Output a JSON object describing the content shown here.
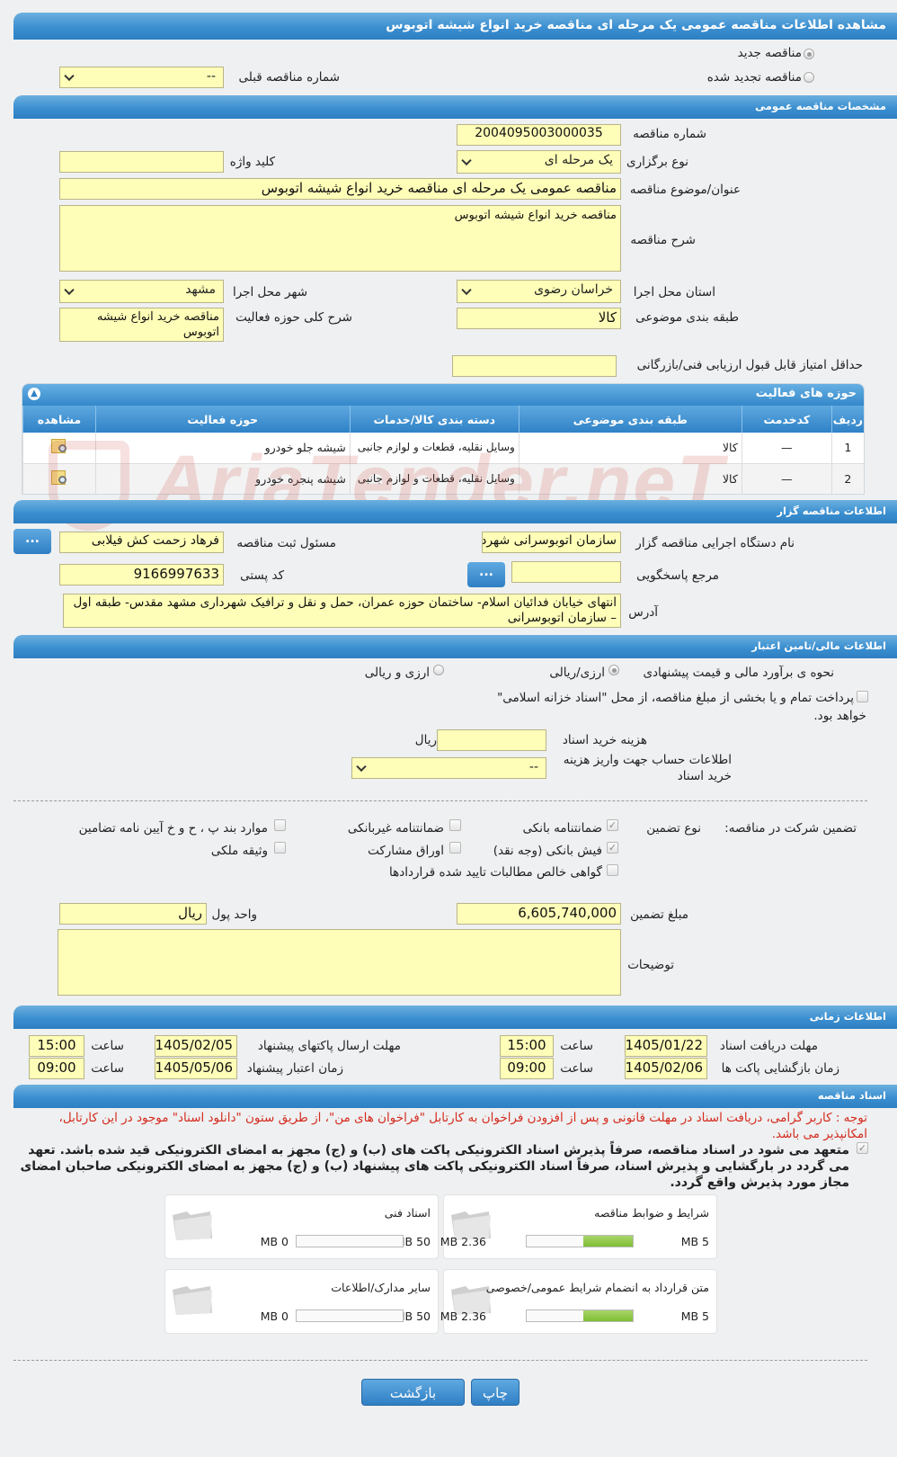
{
  "header": {
    "title": "مشاهده اطلاعات مناقصه عمومی یک مرحله ای مناقصه خرید انواع شیشه اتوبوس"
  },
  "tender_type": {
    "new_label": "مناقصه جدید",
    "renewed_label": "مناقصه تجدید شده",
    "prev_number_label": "شماره مناقصه قبلی",
    "prev_number_value": "--"
  },
  "general": {
    "section_title": "مشخصات مناقصه عمومی",
    "number_label": "شماره مناقصه",
    "number_value": "2004095003000035",
    "holding_type_label": "نوع برگزاری",
    "holding_type_value": "یک مرحله ای",
    "keyword_label": "کلید واژه",
    "keyword_value": "",
    "subject_label": "عنوان/موضوع مناقصه",
    "subject_value": "مناقصه عمومی یک مرحله ای مناقصه خرید انواع شیشه اتوبوس",
    "description_label": "شرح مناقصه",
    "description_value": "مناقصه خرید انواع شیشه اتوبوس",
    "province_label": "استان محل اجرا",
    "province_value": "خراسان رضوی",
    "city_label": "شهر محل اجرا",
    "city_value": "مشهد",
    "category_label": "طبقه بندی موضوعی",
    "category_value": "کالا",
    "activity_desc_label": "شرح کلی حوزه فعالیت",
    "activity_desc_value": "مناقصه خرید انواع شیشه اتوبوس",
    "min_score_label": "حداقل امتیاز قابل قبول ارزیابی فنی/بازرگانی",
    "min_score_value": ""
  },
  "activity": {
    "title": "حوزه های فعالیت",
    "columns": [
      "ردیف",
      "کدخدمت",
      "طبقه بندی موضوعی",
      "دسته بندی کالا/خدمات",
      "حوزه فعالیت",
      "مشاهده"
    ],
    "rows": [
      {
        "no": "1",
        "code": "—",
        "category": "کالا",
        "group": "وسایل نقلیه، قطعات و لوازم جانبی",
        "field": "شیشه جلو خودرو"
      },
      {
        "no": "2",
        "code": "—",
        "category": "کالا",
        "group": "وسایل نقلیه، قطعات و لوازم جانبی",
        "field": "شیشه پنجره خودرو"
      }
    ]
  },
  "organizer": {
    "section_title": "اطلاعات مناقصه گزار",
    "org_label": "نام دستگاه اجرایی مناقصه گزار",
    "org_value": "سازمان اتوبوسرانی شهرداری مشهد",
    "registrar_label": "مسئول ثبت مناقصه",
    "registrar_value": "فرهاد زحمت کش فیلابی",
    "ref_label": "مرجع پاسخگویی",
    "ref_value": "",
    "postal_label": "کد پستی",
    "postal_value": "9166997633",
    "address_label": "آدرس",
    "address_value": "انتهای خیابان فدائیان اسلام- ساختمان حوزه عمران، حمل و نقل و ترافیک شهرداری مشهد مقدس- طبقه اول – سازمان اتوبوسرانی",
    "dots": "..."
  },
  "finance": {
    "section_title": "اطلاعات مالی/تامین اعتبار",
    "estimate_label": "نحوه ی برآورد مالی و قیمت پیشنهادی",
    "opt1": "ارزی/ریالی",
    "opt2": "ارزی و ریالی",
    "treasury_text": "پرداخت تمام و یا بخشی از مبلغ مناقصه، از محل \"اسناد خزانه اسلامی\"",
    "treasury_text2": "خواهد بود.",
    "doc_cost_label": "هزینه خرید اسناد",
    "doc_cost_value": "",
    "doc_cost_unit": "ریال",
    "account_label": "اطلاعات حساب جهت واریز هزینه خرید اسناد",
    "account_value": "--"
  },
  "guarantee": {
    "label": "تضمین شرکت در مناقصه:",
    "type_label": "نوع تضمین",
    "items": {
      "bank_guarantee": "ضمانتنامه بانکی",
      "nonbank_guarantee": "ضمانتنامه غیربانکی",
      "clauses": "موارد بند پ ، ح و خ آیین نامه تضامین",
      "bank_receipt": "فیش بانکی (وجه نقد)",
      "bonds": "اوراق مشارکت",
      "property": "وثیقه ملکی",
      "claims": "گواهی خالص مطالبات تایید شده قراردادها"
    },
    "amount_label": "مبلغ تضمین",
    "amount_value": "6,605,740,000",
    "currency_label": "واحد پول",
    "currency_value": "ریال",
    "notes_label": "توضیحات",
    "notes_value": ""
  },
  "timing": {
    "section_title": "اطلاعات زمانی",
    "doc_deadline_label": "مهلت دریافت اسناد",
    "doc_deadline_date": "1405/01/22",
    "doc_deadline_time": "15:00",
    "send_deadline_label": "مهلت ارسال پاکتهای پیشنهاد",
    "send_deadline_date": "1405/02/05",
    "send_deadline_time": "15:00",
    "opening_label": "زمان بازگشایی پاکت ها",
    "opening_date": "1405/02/06",
    "opening_time": "09:00",
    "validity_label": "زمان اعتبار پیشنهاد",
    "validity_date": "1405/05/06",
    "validity_time": "09:00",
    "time_label": "ساعت"
  },
  "documents": {
    "section_title": "اسناد مناقصه",
    "notice": "توجه : کاربر گرامی، دریافت اسناد در مهلت قانونی و پس از افزودن فراخوان به کارتابل \"فراخوان های من\"، از طریق ستون \"دانلود اسناد\" موجود در این کارتابل، امکانپذیر می باشد.",
    "commitment": "متعهد می شود در اسناد مناقصه، صرفاً پذیرش اسناد الکترونیکی پاکت های (ب) و (ج) مجهز به امضای الکترونیکی قید شده باشد. تعهد می گردد در بارگشایی و پذیرش اسناد، صرفاً اسناد الکترونیکی پاکت های پیشنهاد (ب) و (ج) مجهز به امضای الکترونیکی صاحبان امضای مجاز مورد پذیرش واقع گردد.",
    "cards": [
      {
        "title": "شرایط و ضوابط مناقصه",
        "size": "2.36 MB",
        "max": "5 MB",
        "fill": 0.47
      },
      {
        "title": "اسناد فنی",
        "size": "0 MB",
        "max": "50 MB",
        "fill": 0
      },
      {
        "title": "متن قرارداد به انضمام شرایط عمومی/خصوصی",
        "size": "2.36 MB",
        "max": "5 MB",
        "fill": 0.47
      },
      {
        "title": "سایر مدارک/اطلاعات",
        "size": "0 MB",
        "max": "50 MB",
        "fill": 0
      }
    ]
  },
  "footer": {
    "print_label": "چاپ",
    "back_label": "بازگشت"
  },
  "watermark": "AriaTender.neT"
}
